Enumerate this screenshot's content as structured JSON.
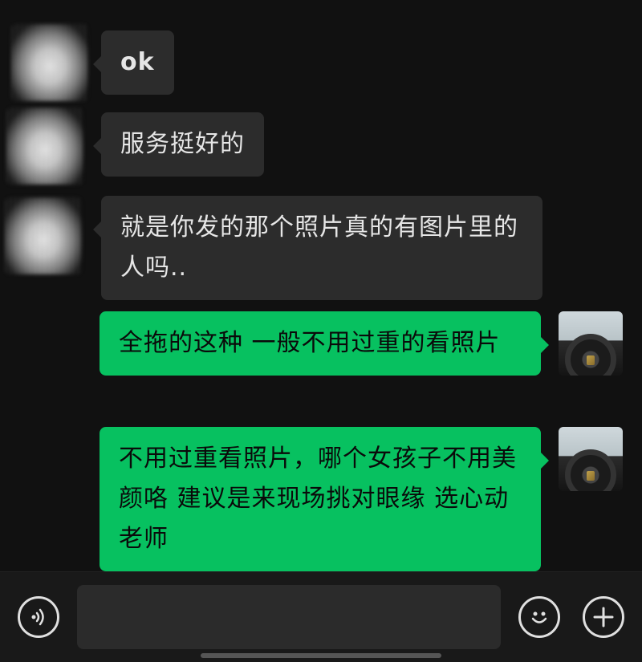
{
  "conversation": {
    "messages": [
      {
        "side": "incoming",
        "text": "ok"
      },
      {
        "side": "incoming",
        "text": "服务挺好的"
      },
      {
        "side": "incoming",
        "text": "就是你发的那个照片真的有图片里的人吗.."
      },
      {
        "side": "outgoing",
        "text": "全拖的这种 一般不用过重的看照片"
      },
      {
        "side": "outgoing",
        "text": "不用过重看照片，哪个女孩子不用美颜咯 建议是来现场挑对眼缘 选心动老师"
      }
    ]
  },
  "input_bar": {
    "voice_icon": "voice-icon",
    "emoji_icon": "emoji-icon",
    "add_icon": "plus-icon",
    "text": ""
  },
  "colors": {
    "background": "#111111",
    "incoming_bubble": "#2c2c2c",
    "outgoing_bubble": "#07c160"
  }
}
